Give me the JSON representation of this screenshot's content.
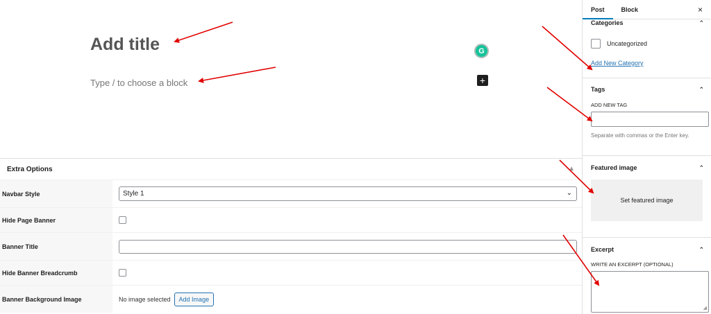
{
  "editor": {
    "title_placeholder": "Add title",
    "block_placeholder": "Type / to choose a block",
    "grammarly_icon": "G",
    "add_block_icon": "+"
  },
  "extra_options": {
    "header": "Extra Options",
    "rows": [
      {
        "label": "Navbar Style",
        "type": "select",
        "value": "Style 1"
      },
      {
        "label": "Hide Page Banner",
        "type": "checkbox",
        "checked": false
      },
      {
        "label": "Banner Title",
        "type": "text",
        "value": ""
      },
      {
        "label": "Hide Banner Breadcrumb",
        "type": "checkbox",
        "checked": false
      },
      {
        "label": "Banner Background Image",
        "type": "image",
        "status": "No image selected",
        "button": "Add Image"
      }
    ]
  },
  "sidebar": {
    "tabs": [
      {
        "label": "Post",
        "active": true
      },
      {
        "label": "Block",
        "active": false
      }
    ],
    "close_icon": "×",
    "categories": {
      "title": "Categories",
      "items": [
        {
          "label": "Uncategorized",
          "checked": false
        }
      ],
      "add_link": "Add New Category"
    },
    "tags": {
      "title": "Tags",
      "field_label": "ADD NEW TAG",
      "help": "Separate with commas or the Enter key."
    },
    "featured_image": {
      "title": "Featured image",
      "button": "Set featured image"
    },
    "excerpt": {
      "title": "Excerpt",
      "field_label": "WRITE AN EXCERPT (OPTIONAL)"
    }
  },
  "colors": {
    "accent": "#2271b1",
    "tab_indicator": "#007cba",
    "annotation_arrow": "#e00000",
    "grammarly": "#15c39a"
  }
}
